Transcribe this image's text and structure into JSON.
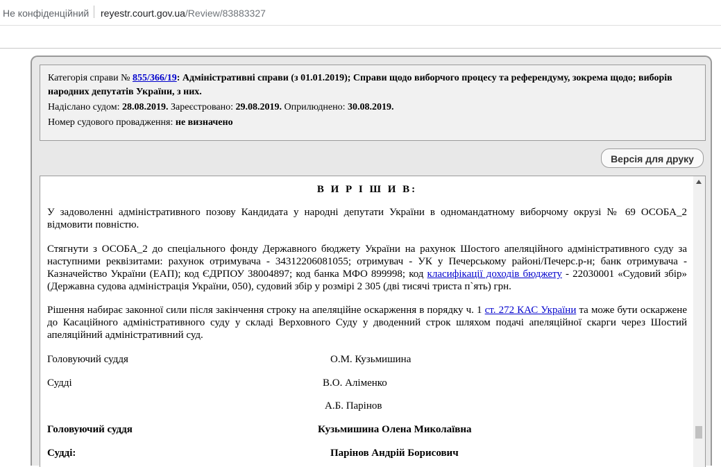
{
  "browser": {
    "security_label": "Не конфіденційний",
    "url_host": "reyestr.court.gov.ua",
    "url_path": "/Review/83883327"
  },
  "info": {
    "category_prefix": "Категорія справи №",
    "case_number": "855/366/19",
    "category_text": ": Адміністративні справи (з 01.01.2019); Справи щодо виборчого процесу та референдуму, зокрема щодо; виборів народних депутатів України, з них.",
    "sent_label": "Надіслано судом:",
    "sent_date": "28.08.2019.",
    "registered_label": "Зареєстровано:",
    "registered_date": "29.08.2019.",
    "published_label": "Оприлюднено:",
    "published_date": "30.08.2019.",
    "proceeding_label": "Номер судового провадження:",
    "proceeding_value": "не визначено"
  },
  "print_button_label": "Версія для друку",
  "document": {
    "heading": "В И Р І Ш И В:",
    "paragraph1": "У задоволенні адміністративного позову Кандидата у народні депутати України в одномандатному виборчому окрузі № 69 ОСОБА_2 відмовити повністю.",
    "paragraph2_part1": "Стягнути з ОСОБА_2 до спеціального фонду Державного бюджету України на рахунок Шостого апеляційного адміністративного суду за наступними реквізитами: рахунок отримувача - 34312206081055; отримувач - УК у Печерському районі/Печерс.р-н; банк отримувача - Казначейство України (ЕАП); код ЄДРПОУ 38004897; код банка МФО 899998; код ",
    "paragraph2_link": "класифікації доходів бюджету",
    "paragraph2_part2": " - 22030001 «Судовий збір» (Державна судова адміністрація України, 050), судовий збір у розмірі 2 305 (дві тисячі триста п`ять) грн.",
    "paragraph3_part1": "Рішення набирає законної сили після закінчення строку на апеляційне оскарження в порядку ч. 1 ",
    "paragraph3_link": "ст. 272 КАС України",
    "paragraph3_part2": " та може бути оскаржене до Касаційного адміністративного суду у складі Верховного Суду у дводенний строк шляхом подачі апеляційної скарги через Шостий апеляційний адміністративний суд.",
    "presiding_label": "Головуючий суддя",
    "presiding_name": "О.М. Кузьмишина",
    "judges_label": "Судді",
    "judge1_name": "В.О. Аліменко",
    "judge2_name": "А.Б. Парінов",
    "presiding_label_full": "Головуючий суддя",
    "presiding_full_name": "Кузьмишина Олена Миколаївна",
    "judges_label_full": "Судді:",
    "judge2_full_name": "Парінов Андрій Борисович"
  }
}
